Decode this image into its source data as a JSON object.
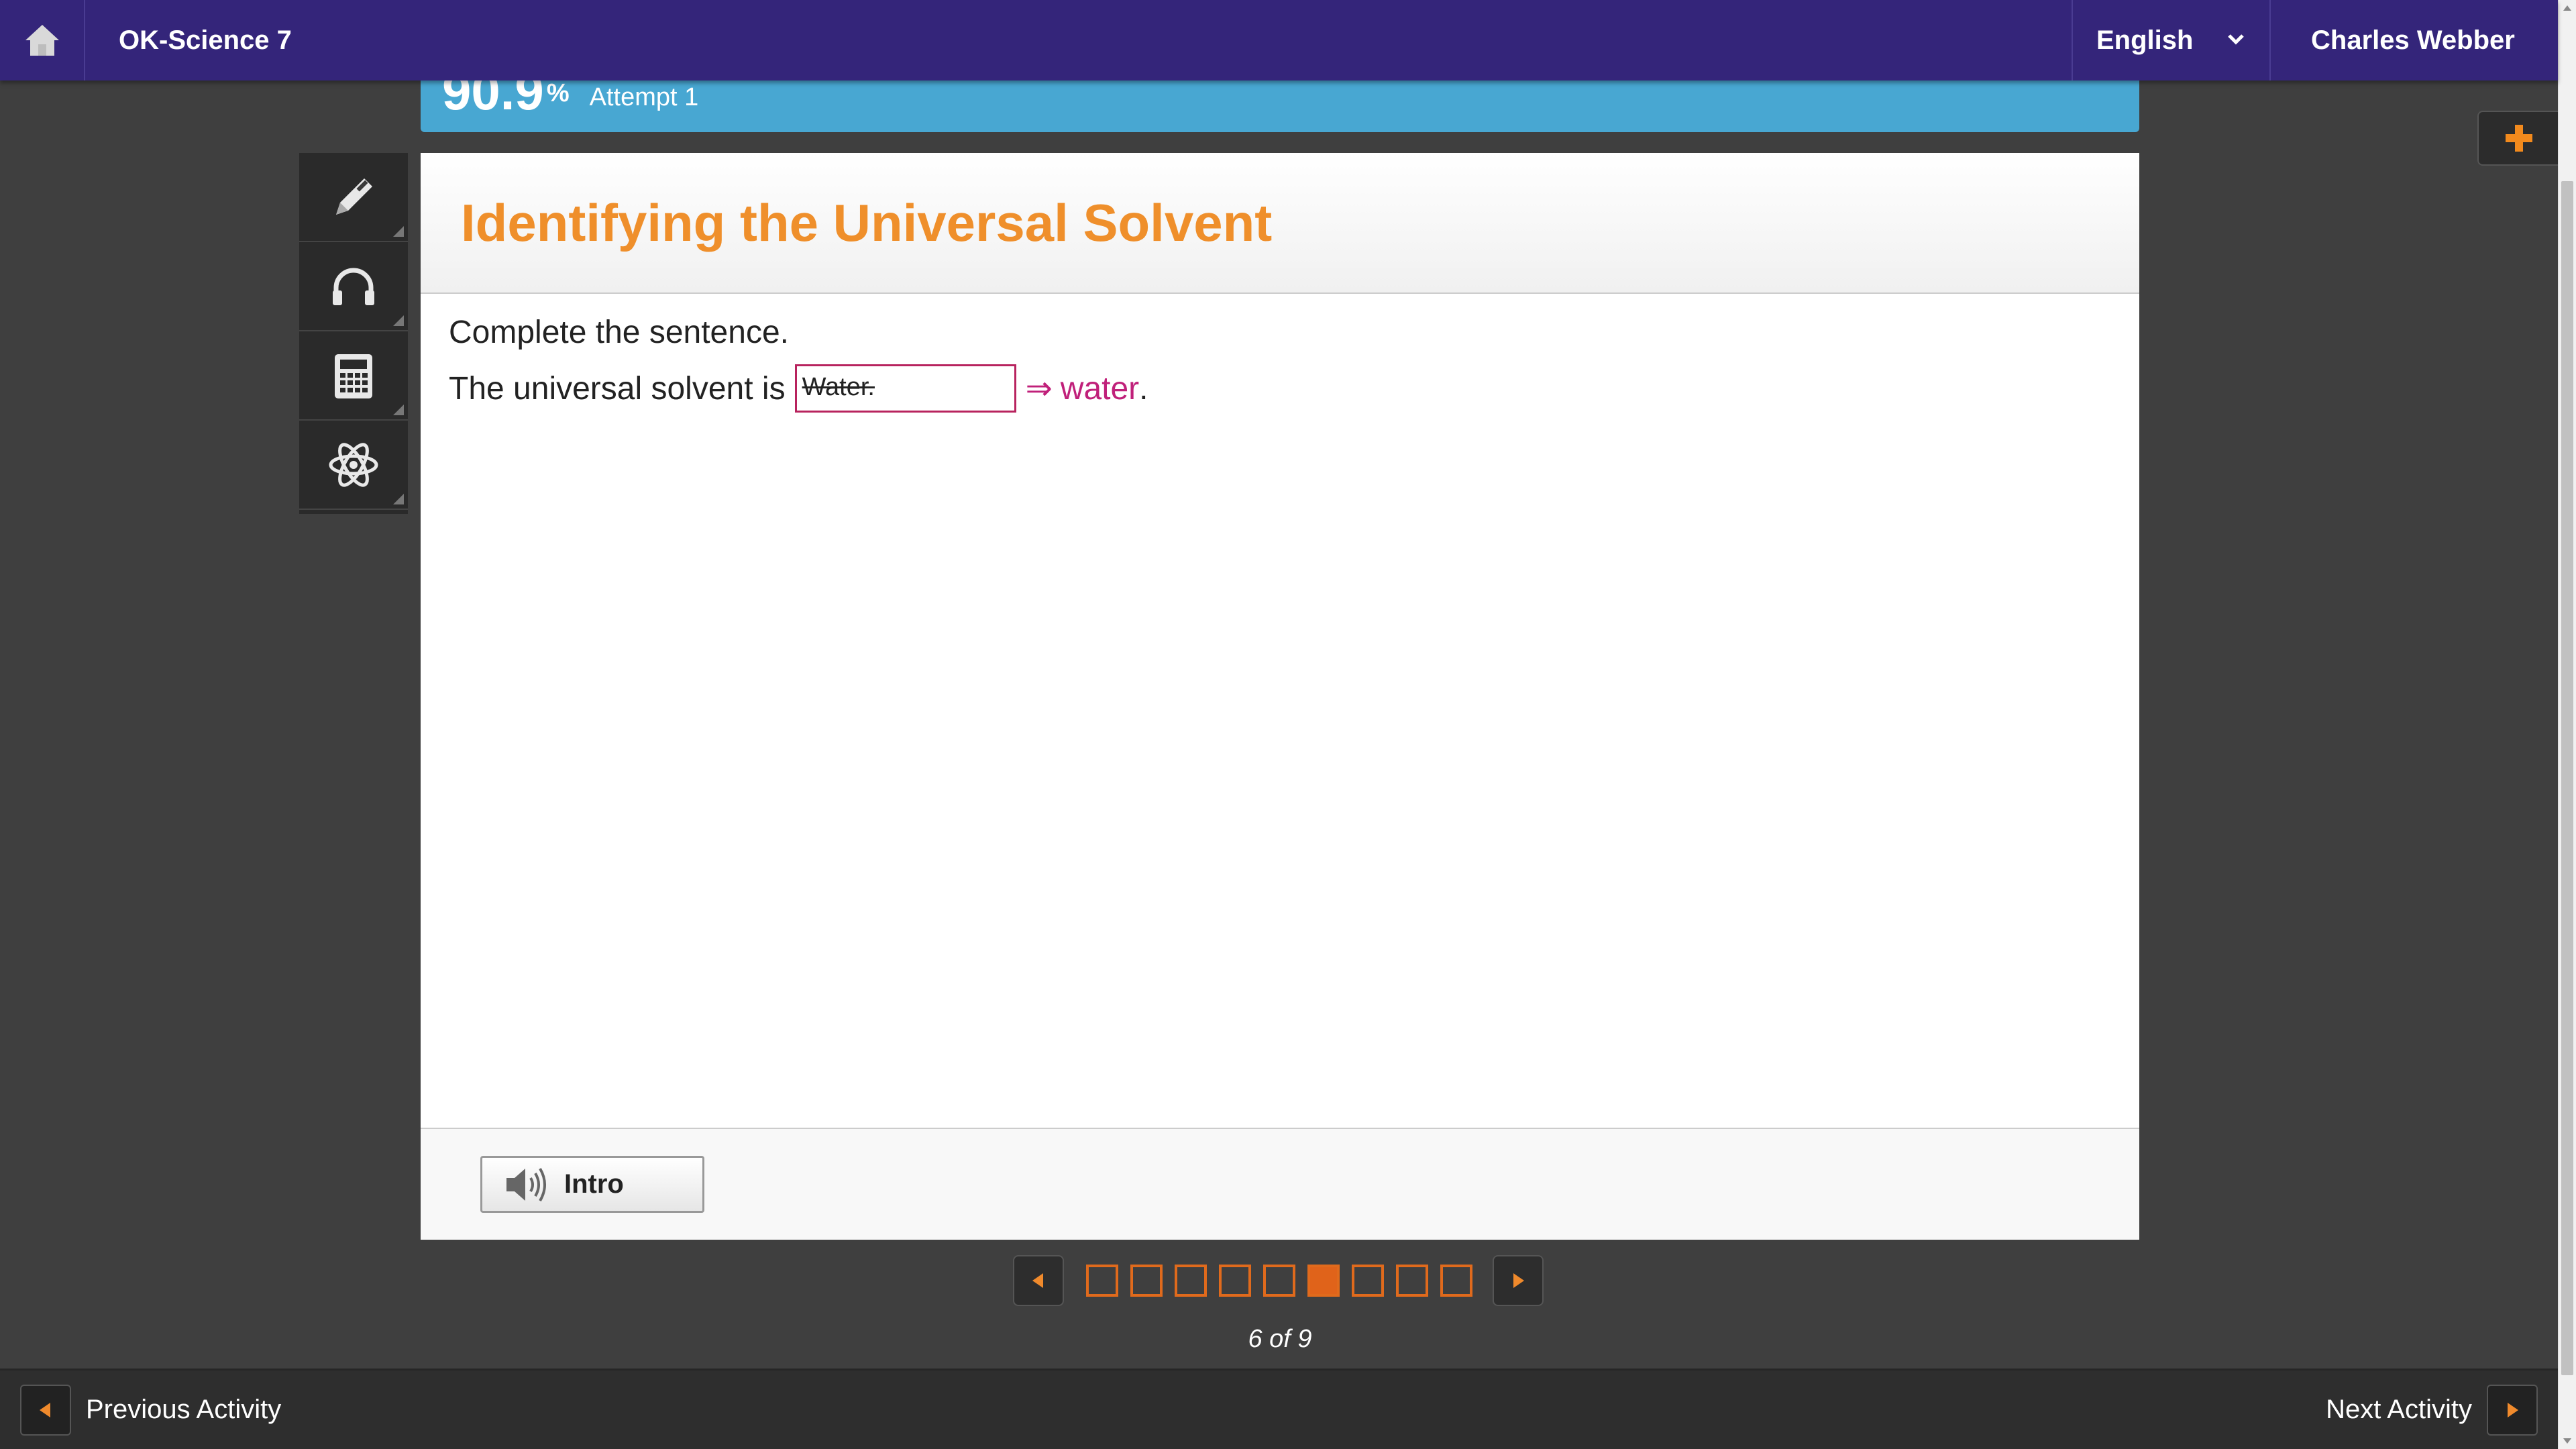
{
  "header": {
    "app_title": "OK-Science 7",
    "language": "English",
    "user_name": "Charles Webber"
  },
  "score": {
    "value": "90.9",
    "unit": "%",
    "attempt": "Attempt 1"
  },
  "tools": [
    "pencil-icon",
    "headphones-icon",
    "calculator-icon",
    "atom-icon"
  ],
  "activity": {
    "title": "Identifying the Universal Solvent",
    "prompt": "Complete the sentence.",
    "sentence_prefix": "The universal solvent is",
    "student_answer": "Water.",
    "correction_arrow": "⇒",
    "correct_answer": "water",
    "sentence_suffix": "."
  },
  "footer": {
    "intro_label": "Intro"
  },
  "pager": {
    "total": 9,
    "current": 6,
    "label": "6 of 9"
  },
  "bottom_nav": {
    "previous_label": "Previous Activity",
    "next_label": "Next Activity"
  },
  "colors": {
    "topbar": "#34257a",
    "scorebar": "#48a7d2",
    "title_orange": "#ef8f2b",
    "correction_magenta": "#c0207a",
    "pager_orange": "#e0631a"
  }
}
